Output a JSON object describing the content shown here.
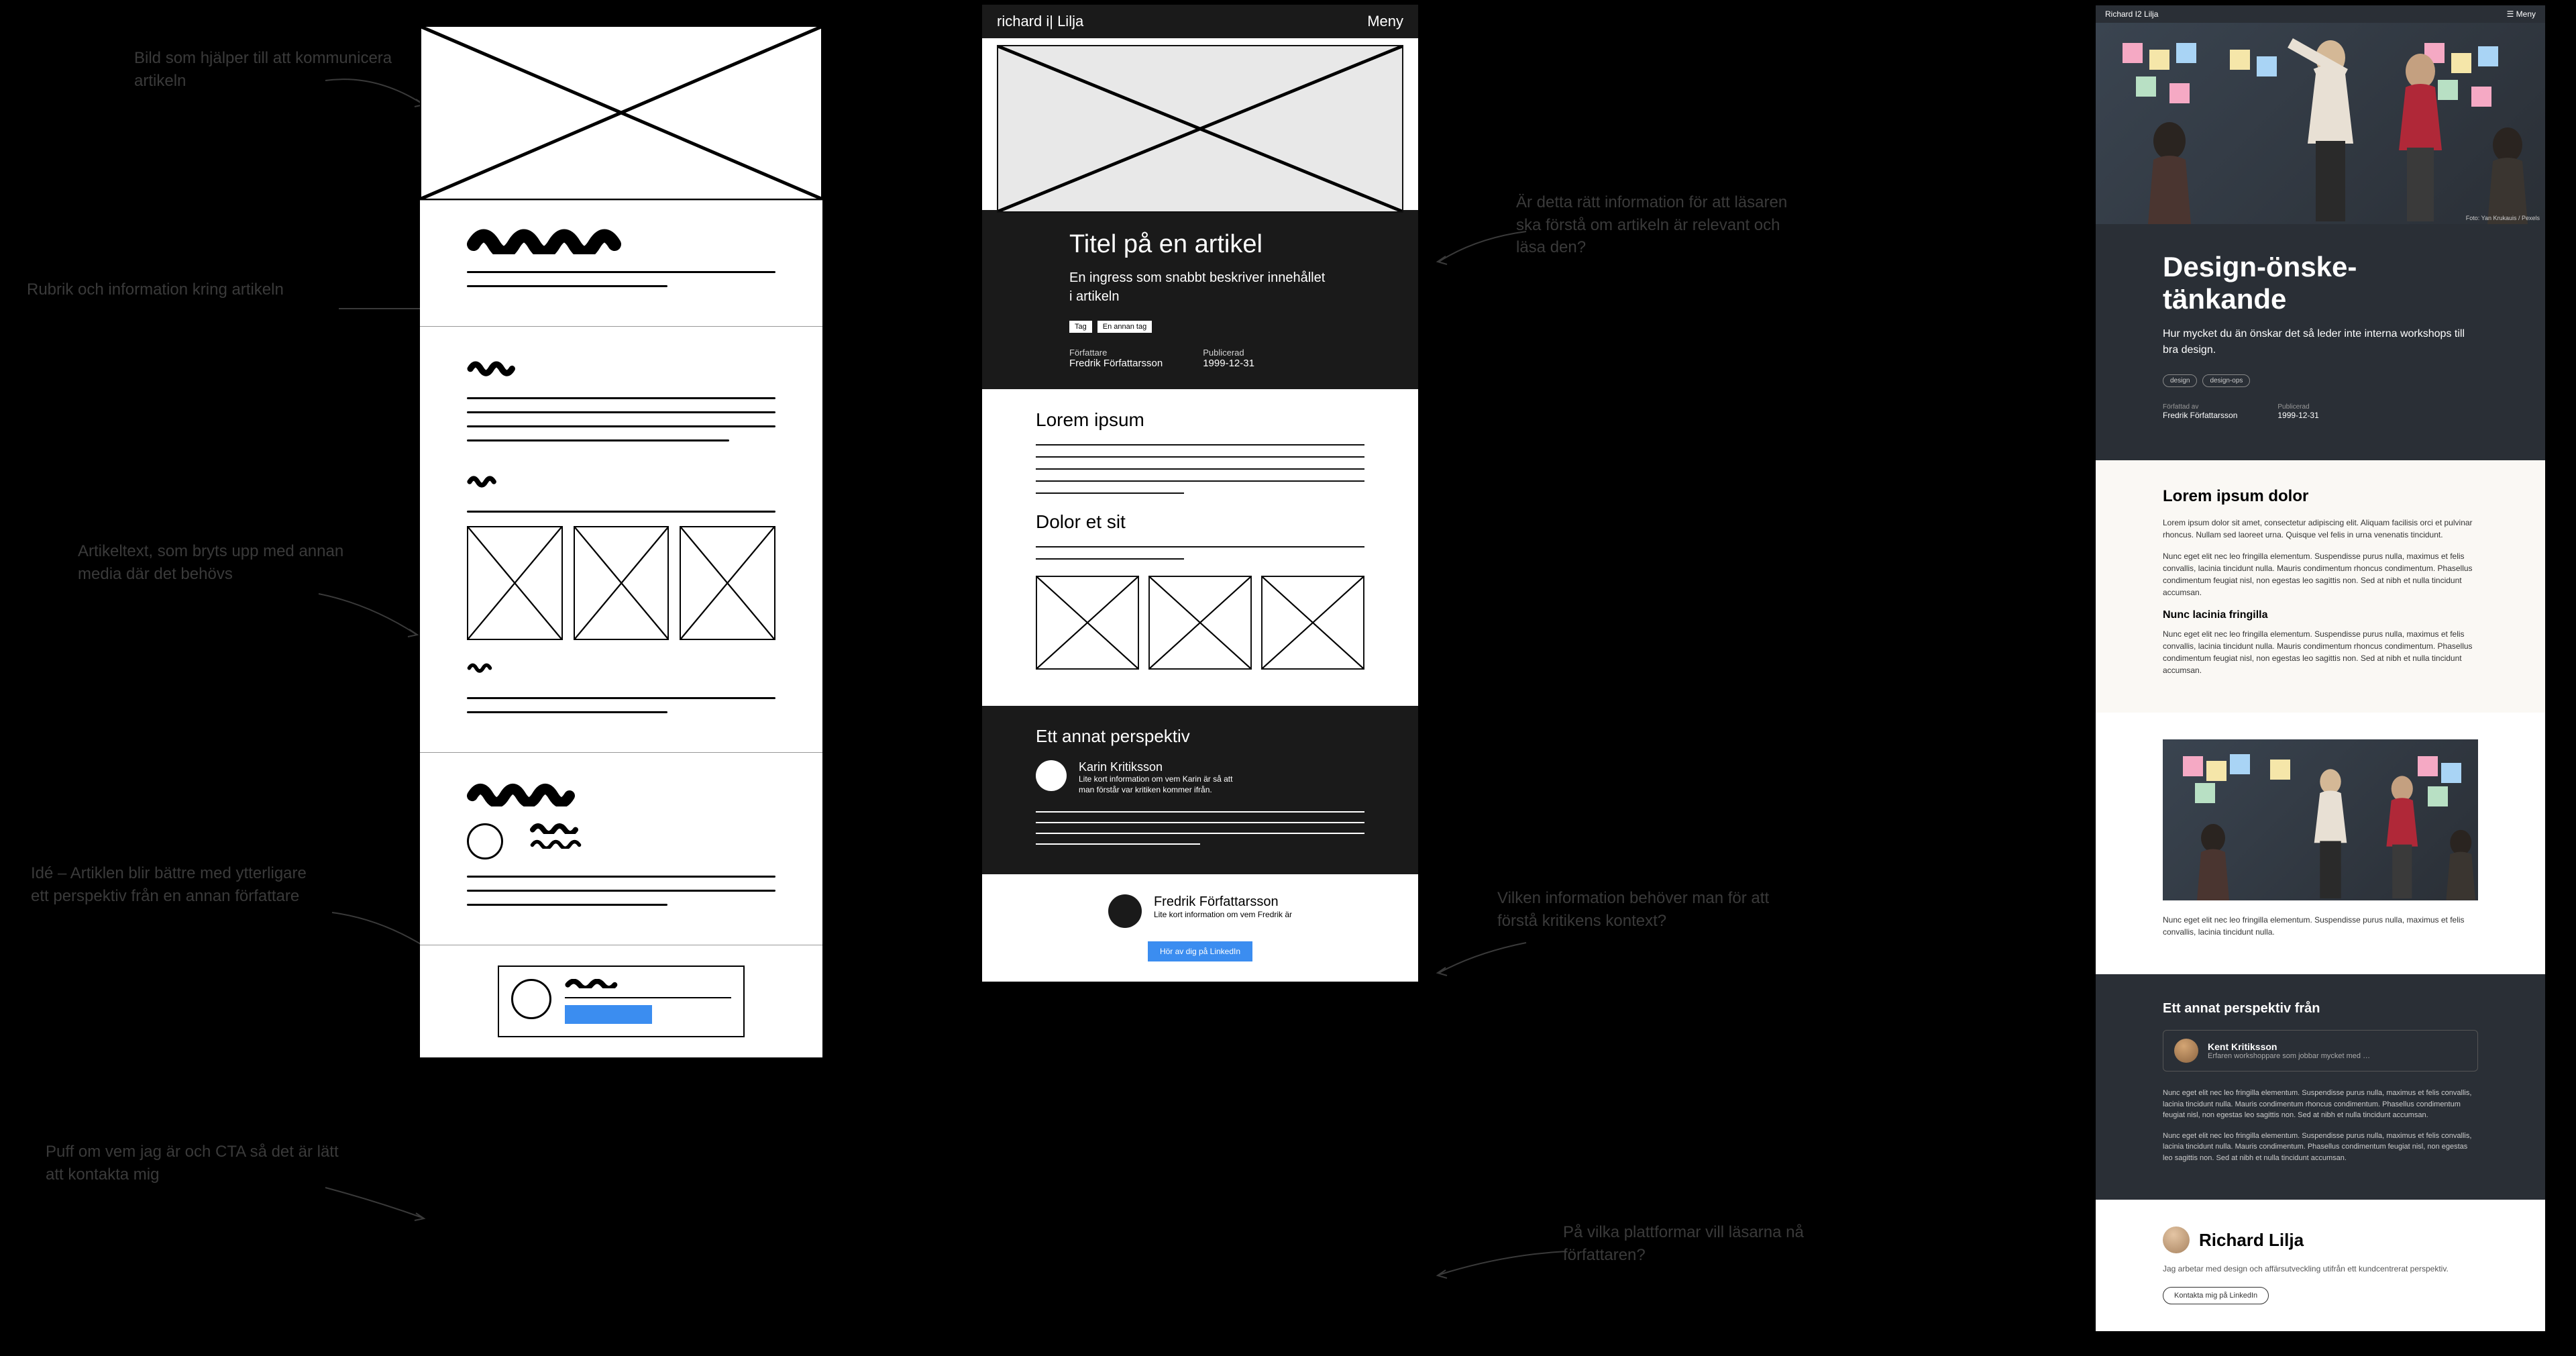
{
  "annotations": {
    "a1": "Bild som hjälper till att kommunicera artikeln",
    "a2": "Rubrik och information kring artikeln",
    "a3": "Artikeltext, som bryts upp med annan media där det behövs",
    "a4": "Idé – Artiklen blir bättre med ytterligare ett perspektiv från en annan författare",
    "a5": "Puff om vem jag är och CTA så det är lätt att kontakta mig",
    "a6": "Är detta rätt information för att läsaren ska förstå om artikeln är relevant och läsa den?",
    "a7": "Vilken information behöver man för att förstå kritikens kontext?",
    "a8": "På vilka plattformar vill läsarna nå författaren?"
  },
  "lofi": {
    "brand": "richard i| Lilja",
    "menu": "Meny",
    "title": "Titel på en artikel",
    "ingress": "En ingress som snabbt beskriver innehållet i artikeln",
    "tag1": "Tag",
    "tag2": "En annan tag",
    "author_label": "Författare",
    "author": "Fredrik Författarsson",
    "pub_label": "Publicerad",
    "pub": "1999-12-31",
    "h2a": "Lorem ipsum",
    "h2b": "Dolor et sit",
    "p_title": "Ett annat perspektiv",
    "p_name": "Karin Kritiksson",
    "p_bio": "Lite kort information om vem Karin är så att man förstår var kritiken kommer ifrån.",
    "f_name": "Fredrik Författarsson",
    "f_bio": "Lite kort information om vem Fredrik är",
    "cta": "Hör av dig på LinkedIn"
  },
  "hifi": {
    "brand": "Richard I2 Lilja",
    "menu": "☰ Meny",
    "credit": "Foto: Yan Krukauis / Pexels",
    "title": "Design-önske-tänkande",
    "ingress": "Hur mycket du än önskar det så leder inte interna workshops till bra design.",
    "tag1": "design",
    "tag2": "design-ops",
    "author_label": "Författad av",
    "author": "Fredrik Författarsson",
    "pub_label": "Publicerad",
    "pub": "1999-12-31",
    "h2": "Lorem ipsum dolor",
    "p1": "Lorem ipsum dolor sit amet, consectetur adipiscing elit. Aliquam facilisis orci et pulvinar rhoncus. Nullam sed laoreet urna. Quisque vel felis in urna venenatis tincidunt.",
    "p2": "Nunc eget elit nec leo fringilla elementum. Suspendisse purus nulla, maximus et felis convallis, lacinia tincidunt nulla. Mauris condimentum rhoncus condimentum. Phasellus condimentum feugiat nisl, non egestas leo sagittis non. Sed at nibh et nulla tincidunt accumsan.",
    "h3": "Nunc lacinia fringilla",
    "p3": "Nunc eget elit nec leo fringilla elementum. Suspendisse purus nulla, maximus et felis convallis, lacinia tincidunt nulla. Mauris condimentum rhoncus condimentum. Phasellus condimentum feugiat nisl, non egestas leo sagittis non. Sed at nibh et nulla tincidunt accumsan.",
    "p4": "Nunc eget elit nec leo fringilla elementum. Suspendisse purus nulla, maximus et felis convallis, lacinia tincidunt nulla.",
    "pt": "Ett annat perspektiv från",
    "pn": "Kent Kritiksson",
    "pb": "Erfaren workshoppare som jobbar mycket med …",
    "pp1": "Nunc eget elit nec leo fringilla elementum. Suspendisse purus nulla, maximus et felis convallis, lacinia tincidunt nulla. Mauris condimentum rhoncus condimentum. Phasellus condimentum feugiat nisl, non egestas leo sagittis non. Sed at nibh et nulla tincidunt accumsan.",
    "pp2": "Nunc eget elit nec leo fringilla elementum. Suspendisse purus nulla, maximus et felis convallis, lacinia tincidunt nulla. Mauris condimentum. Phasellus condimentum feugiat nisl, non egestas leo sagittis non. Sed at nibh et nulla tincidunt accumsan.",
    "fn": "Richard Lilja",
    "fb": "Jag arbetar med design och affärsutveckling utifrån ett kundcentrerat perspektiv.",
    "fc": "Kontakta mig på LinkedIn"
  }
}
